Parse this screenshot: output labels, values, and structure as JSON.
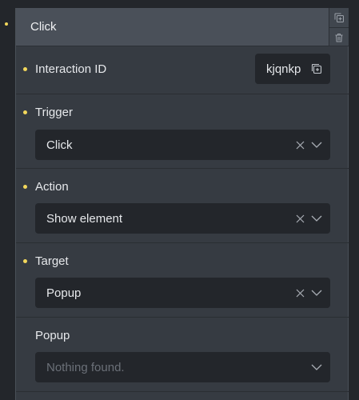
{
  "interaction": {
    "title": "Click",
    "id_label": "Interaction ID",
    "id_value": "kjqnkp"
  },
  "fields": {
    "trigger": {
      "label": "Trigger",
      "value": "Click"
    },
    "action": {
      "label": "Action",
      "value": "Show element"
    },
    "target": {
      "label": "Target",
      "value": "Popup"
    },
    "popup": {
      "label": "Popup",
      "placeholder": "Nothing found."
    }
  },
  "icons": {
    "duplicate": "duplicate-icon",
    "delete": "trash-icon",
    "copy": "copy-icon",
    "clear": "close-icon",
    "dropdown": "chevron-down-icon"
  },
  "colors": {
    "accent_dot": "#f2d75b",
    "panel_bg": "#363b42",
    "header_bg": "#4a5059",
    "input_bg": "#23262b"
  }
}
